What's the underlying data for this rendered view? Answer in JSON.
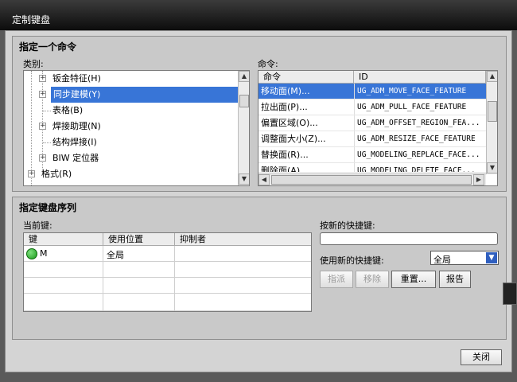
{
  "window": {
    "title": "定制键盘"
  },
  "command_group": {
    "title": "指定一个命令",
    "category_label": "类别:",
    "command_label": "命令:",
    "categories": [
      {
        "label": "钣金特征(H)",
        "expandable": true,
        "selected": false
      },
      {
        "label": "同步建模(Y)",
        "expandable": true,
        "selected": true
      },
      {
        "label": "表格(B)",
        "expandable": false,
        "selected": false
      },
      {
        "label": "焊接助理(N)",
        "expandable": true,
        "selected": false
      },
      {
        "label": "结构焊接(I)",
        "expandable": false,
        "selected": false
      },
      {
        "label": "BIW 定位器",
        "expandable": true,
        "selected": false
      },
      {
        "label": "格式(R)",
        "expandable": true,
        "selected": false
      }
    ],
    "command_headers": {
      "name": "命令",
      "id": "ID"
    },
    "commands": [
      {
        "name": "移动面(M)...",
        "id": "UG_ADM_MOVE_FACE_FEATURE",
        "selected": true
      },
      {
        "name": "拉出面(P)...",
        "id": "UG_ADM_PULL_FACE_FEATURE",
        "selected": false
      },
      {
        "name": "偏置区域(O)...",
        "id": "UG_ADM_OFFSET_REGION_FEA...",
        "selected": false
      },
      {
        "name": "调整面大小(Z)...",
        "id": "UG_ADM_RESIZE_FACE_FEATURE",
        "selected": false
      },
      {
        "name": "替换面(R)...",
        "id": "UG_MODELING_REPLACE_FACE...",
        "selected": false
      },
      {
        "name": "删除面(A)...",
        "id": "UG_MODELING_DELETE_FACE...",
        "selected": false
      }
    ]
  },
  "keyseq_group": {
    "title": "指定键盘序列",
    "current_keys_label": "当前键:",
    "headers": {
      "key": "键",
      "location": "使用位置",
      "inhibitor": "抑制者"
    },
    "rows": [
      {
        "key": "M",
        "location": "全局",
        "inhibitor": ""
      }
    ],
    "new_shortcut_label": "按新的快捷键:",
    "new_shortcut_value": "",
    "use_new_label": "使用新的快捷键:",
    "use_new_value": "全局",
    "buttons": {
      "assign": "指派",
      "remove": "移除",
      "reset": "重置...",
      "report": "报告"
    },
    "status_color": "#1a9a1a"
  },
  "footer": {
    "close": "关闭"
  }
}
